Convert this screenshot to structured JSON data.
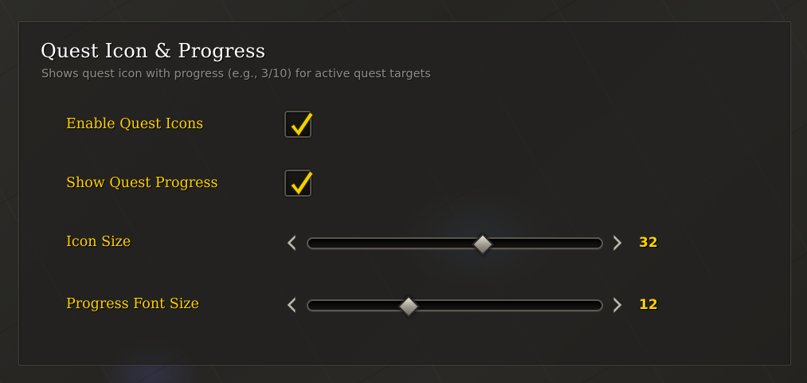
{
  "panel": {
    "title": "Quest Icon & Progress",
    "subtitle": "Shows quest icon with progress (e.g., 3/10) for active quest targets"
  },
  "settings": {
    "enable_quest_icons": {
      "label": "Enable Quest Icons",
      "checked": true
    },
    "show_quest_progress": {
      "label": "Show Quest Progress",
      "checked": true
    },
    "icon_size": {
      "label": "Icon Size",
      "value": "32",
      "fill_fraction": 0.59
    },
    "progress_font_size": {
      "label": "Progress Font Size",
      "value": "12",
      "fill_fraction": 0.34
    }
  },
  "colors": {
    "label_gold": "#ffd200",
    "title_white": "#ffffff",
    "subtitle_gray": "#8f8c85",
    "check_yellow": "#f3d100"
  },
  "icons": {
    "checkmark": "checkmark-icon",
    "decrease": "chevron-left-icon",
    "increase": "chevron-right-icon",
    "thumb": "slider-thumb"
  }
}
